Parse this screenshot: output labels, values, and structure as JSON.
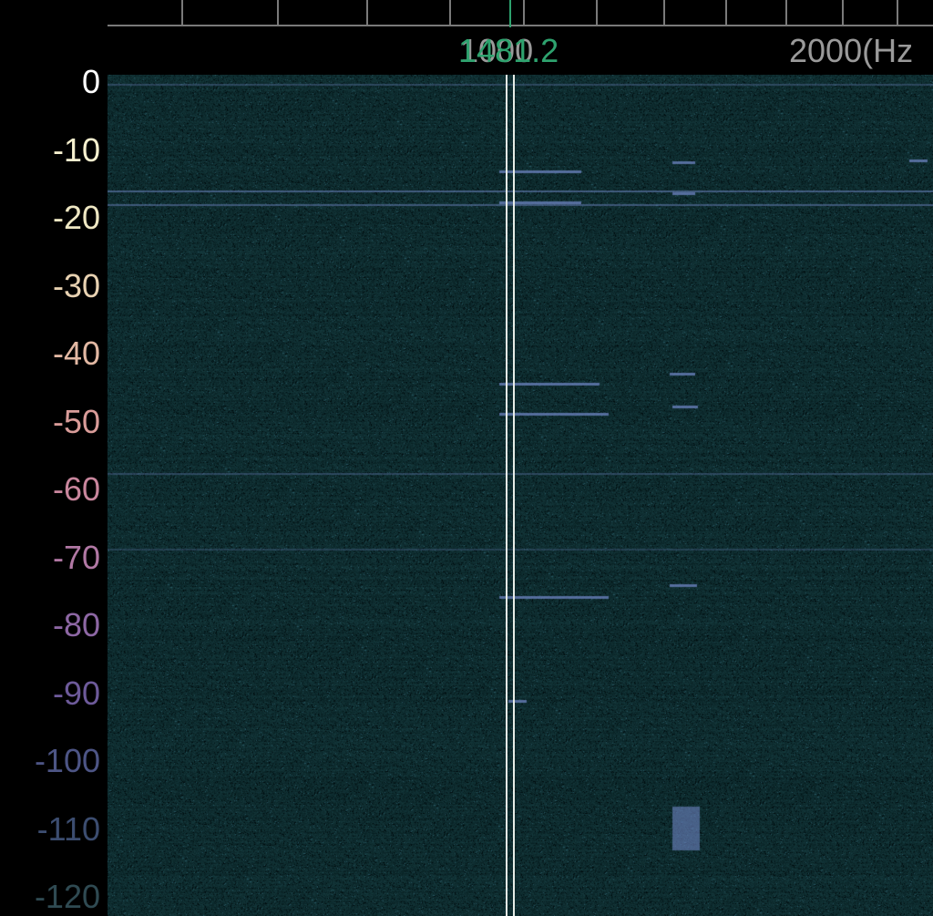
{
  "x_axis": {
    "label_left": "1000",
    "label_right": "2000(Hz",
    "cursor_value": "1481.2",
    "left_label_color": "#9a9a9a",
    "cursor_color": "#2ea26e"
  },
  "y_axis": {
    "ticks": [
      {
        "text": "0",
        "color": "#ffffff"
      },
      {
        "text": "-10",
        "color": "#f6f0cf"
      },
      {
        "text": "-20",
        "color": "#eee7c3"
      },
      {
        "text": "-30",
        "color": "#e8d2b2"
      },
      {
        "text": "-40",
        "color": "#e2b8a3"
      },
      {
        "text": "-50",
        "color": "#d99c99"
      },
      {
        "text": "-60",
        "color": "#c9869d"
      },
      {
        "text": "-70",
        "color": "#b178a4"
      },
      {
        "text": "-80",
        "color": "#8d67a4"
      },
      {
        "text": "-90",
        "color": "#6d5a9a"
      },
      {
        "text": "-100",
        "color": "#4d5585"
      },
      {
        "text": "-110",
        "color": "#3c4d70"
      },
      {
        "text": "-120",
        "color": "#2f4a52"
      }
    ]
  },
  "colors": {
    "background": "#0f2e30",
    "signal": "#6f86c4",
    "cursor_line": "#e6ece6"
  }
}
